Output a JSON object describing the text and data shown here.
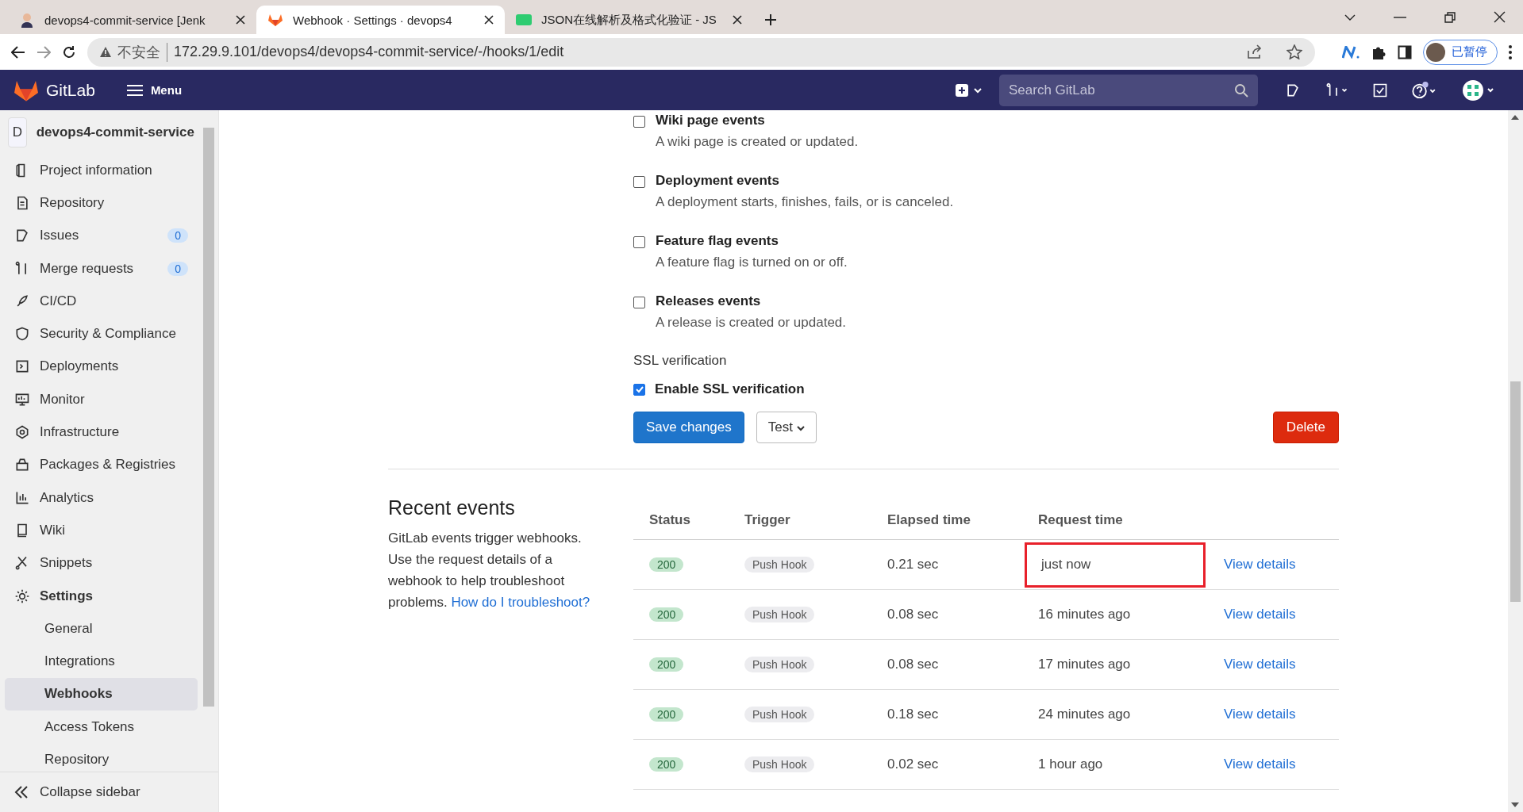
{
  "browser": {
    "tabs": [
      {
        "title": "devops4-commit-service [Jenk",
        "selected": false
      },
      {
        "title": "Webhook · Settings · devops4",
        "selected": true
      },
      {
        "title": "JSON在线解析及格式化验证 - JS",
        "selected": false
      }
    ],
    "security_label": "不安全",
    "url": "172.29.9.101/devops4/devops4-commit-service/-/hooks/1/edit",
    "profile_label": "已暂停"
  },
  "topbar": {
    "brand": "GitLab",
    "menu": "Menu",
    "search": {
      "placeholder": "Search GitLab"
    }
  },
  "sidebar": {
    "project_initial": "D",
    "project_name": "devops4-commit-service",
    "items": [
      {
        "label": "Project information",
        "selected": false
      },
      {
        "label": "Repository",
        "selected": false
      },
      {
        "label": "Issues",
        "badge": "0",
        "selected": false
      },
      {
        "label": "Merge requests",
        "badge": "0",
        "selected": false
      },
      {
        "label": "CI/CD",
        "selected": false
      },
      {
        "label": "Security & Compliance",
        "selected": false
      },
      {
        "label": "Deployments",
        "selected": false
      },
      {
        "label": "Monitor",
        "selected": false
      },
      {
        "label": "Infrastructure",
        "selected": false
      },
      {
        "label": "Packages & Registries",
        "selected": false
      },
      {
        "label": "Analytics",
        "selected": false
      },
      {
        "label": "Wiki",
        "selected": false
      },
      {
        "label": "Snippets",
        "selected": false
      },
      {
        "label": "Settings",
        "selected": true,
        "expanded": true,
        "children": [
          {
            "label": "General",
            "selected": false
          },
          {
            "label": "Integrations",
            "selected": false
          },
          {
            "label": "Webhooks",
            "selected": true
          },
          {
            "label": "Access Tokens",
            "selected": false
          },
          {
            "label": "Repository",
            "selected": false
          }
        ]
      }
    ],
    "collapse": "Collapse sidebar"
  },
  "triggers": [
    {
      "label": "Wiki page events",
      "description": "A wiki page is created or updated.",
      "checked": false
    },
    {
      "label": "Deployment events",
      "description": "A deployment starts, finishes, fails, or is canceled.",
      "checked": false
    },
    {
      "label": "Feature flag events",
      "description": "A feature flag is turned on or off.",
      "checked": false
    },
    {
      "label": "Releases events",
      "description": "A release is created or updated.",
      "checked": false
    }
  ],
  "ssl": {
    "heading": "SSL verification",
    "label": "Enable SSL verification",
    "checked": true
  },
  "buttons": {
    "save": "Save changes",
    "test": "Test",
    "delete": "Delete"
  },
  "recent_events": {
    "title": "Recent events",
    "description": "GitLab events trigger webhooks. Use the request details of a webhook to help troubleshoot problems.",
    "link": "How do I troubleshoot?",
    "columns": [
      "Status",
      "Trigger",
      "Elapsed time",
      "Request time"
    ],
    "rows": [
      {
        "status": "200",
        "trigger": "Push Hook",
        "elapsed": "0.21 sec",
        "request_time": "just now",
        "action": "View details",
        "highlighted": true
      },
      {
        "status": "200",
        "trigger": "Push Hook",
        "elapsed": "0.08 sec",
        "request_time": "16 minutes ago",
        "action": "View details",
        "highlighted": false
      },
      {
        "status": "200",
        "trigger": "Push Hook",
        "elapsed": "0.08 sec",
        "request_time": "17 minutes ago",
        "action": "View details",
        "highlighted": false
      },
      {
        "status": "200",
        "trigger": "Push Hook",
        "elapsed": "0.18 sec",
        "request_time": "24 minutes ago",
        "action": "View details",
        "highlighted": false
      },
      {
        "status": "200",
        "trigger": "Push Hook",
        "elapsed": "0.02 sec",
        "request_time": "1 hour ago",
        "action": "View details",
        "highlighted": false
      }
    ]
  }
}
